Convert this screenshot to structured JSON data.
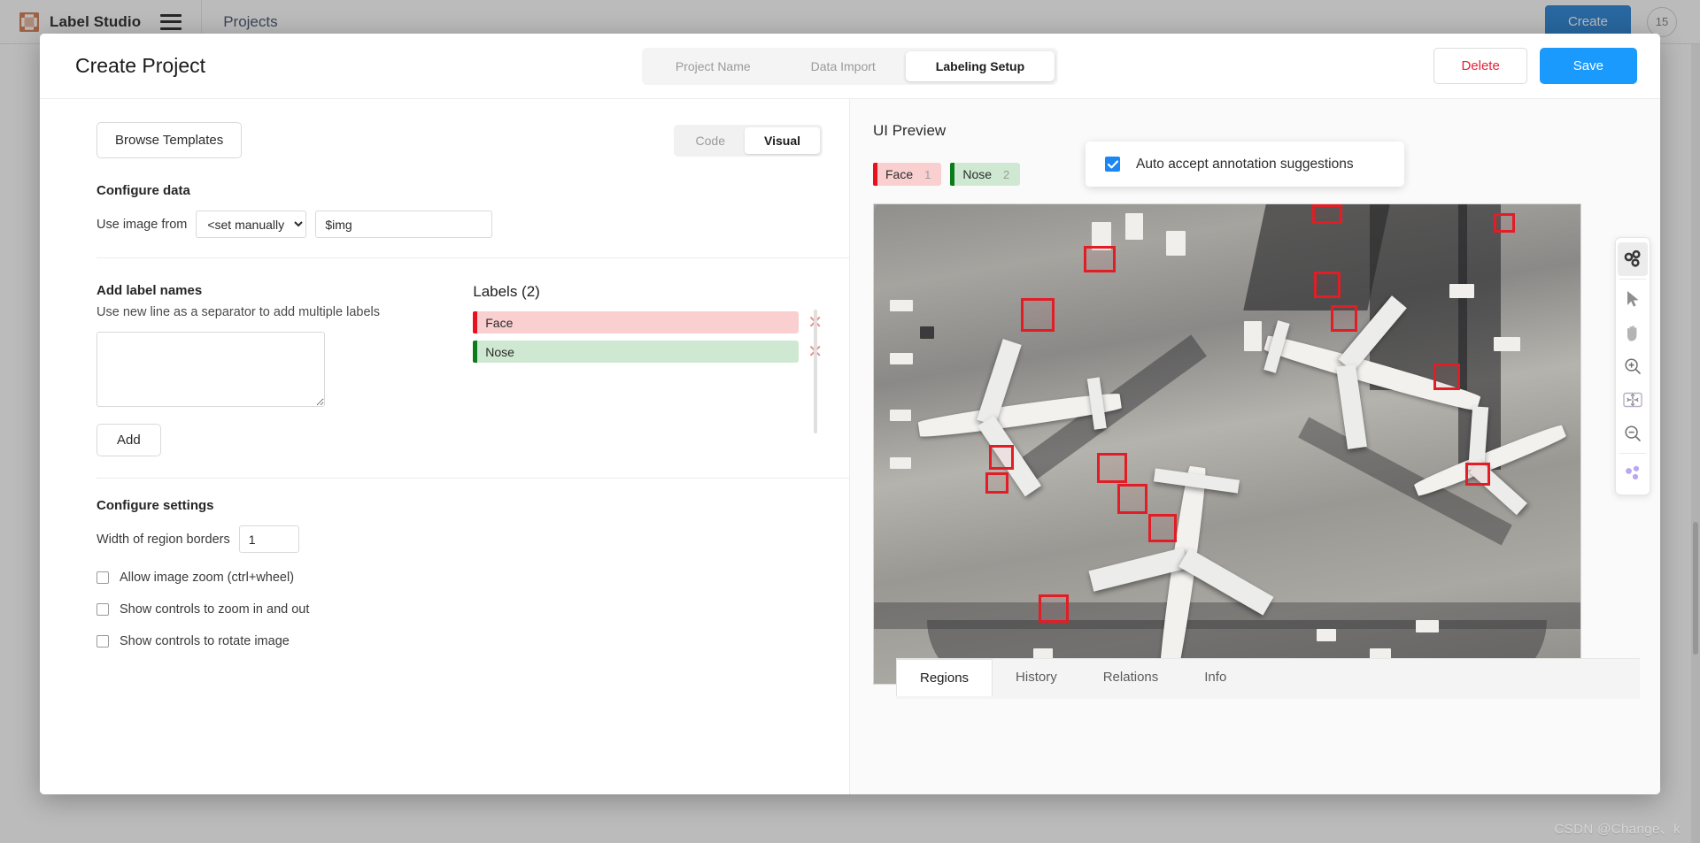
{
  "header": {
    "logo_icon": "label-studio-logo-icon",
    "app_title": "Label Studio",
    "menu_icon": "hamburger-menu-icon",
    "breadcrumb": "Projects",
    "create_label": "Create",
    "count_badge": "15"
  },
  "modal": {
    "title": "Create Project",
    "steps": [
      {
        "label": "Project Name",
        "active": false
      },
      {
        "label": "Data Import",
        "active": false
      },
      {
        "label": "Labeling Setup",
        "active": true
      }
    ],
    "delete_label": "Delete",
    "save_label": "Save"
  },
  "config": {
    "browse_templates_label": "Browse Templates",
    "editor_modes": [
      {
        "label": "Code",
        "active": false
      },
      {
        "label": "Visual",
        "active": true
      }
    ],
    "configure_data": {
      "section_title": "Configure data",
      "use_image_from_label": "Use image from",
      "source_select_value": "<set manually>",
      "source_options": [
        "<set manually>"
      ],
      "value_field": "$img",
      "value_placeholder": "$img"
    },
    "add_labels": {
      "section_title": "Add label names",
      "hint": "Use new line as a separator to add multiple labels",
      "textarea_value": "",
      "textarea_placeholder": "",
      "add_button_label": "Add"
    },
    "labels": {
      "heading": "Labels (2)",
      "items": [
        {
          "name": "Face",
          "color": "#e8111f",
          "background": "#f9cfd0",
          "remove_icon": "close-icon"
        },
        {
          "name": "Nose",
          "color": "#0a7c1c",
          "background": "#cfe8d1",
          "remove_icon": "close-icon"
        }
      ]
    },
    "configure_settings": {
      "section_title": "Configure settings",
      "border_width_label": "Width of region borders",
      "border_width_value": "1",
      "checkboxes": [
        {
          "label": "Allow image zoom (ctrl+wheel)",
          "checked": false
        },
        {
          "label": "Show controls to zoom in and out",
          "checked": false
        },
        {
          "label": "Show controls to rotate image",
          "checked": false
        }
      ]
    }
  },
  "preview": {
    "title": "UI Preview",
    "label_chips": [
      {
        "name": "Face",
        "hotkey": "1",
        "color": "#e8111f",
        "background": "#f9cfd0"
      },
      {
        "name": "Nose",
        "hotkey": "2",
        "color": "#0a7c1c",
        "background": "#cfe8d1"
      }
    ],
    "auto_accept": {
      "label": "Auto accept annotation suggestions",
      "checked": true,
      "accent": "#1a87f4"
    },
    "image_alt": "Aerial photograph of airport apron with parked airplanes and red annotation boxes",
    "toolbar": [
      {
        "icon": "keypoint-tool-icon",
        "active": true
      },
      {
        "icon": "cursor-arrow-icon",
        "active": false
      },
      {
        "icon": "pan-hand-icon",
        "active": false
      },
      {
        "icon": "zoom-in-icon",
        "active": false
      },
      {
        "icon": "fit-to-screen-icon",
        "active": false
      },
      {
        "icon": "zoom-out-icon",
        "active": false
      },
      {
        "icon": "magic-keypoint-icon",
        "active": false
      }
    ],
    "bottom_tabs": [
      {
        "label": "Regions",
        "active": true
      },
      {
        "label": "History",
        "active": false
      },
      {
        "label": "Relations",
        "active": false
      },
      {
        "label": "Info",
        "active": false
      }
    ]
  },
  "watermark": "CSDN @Change、k"
}
